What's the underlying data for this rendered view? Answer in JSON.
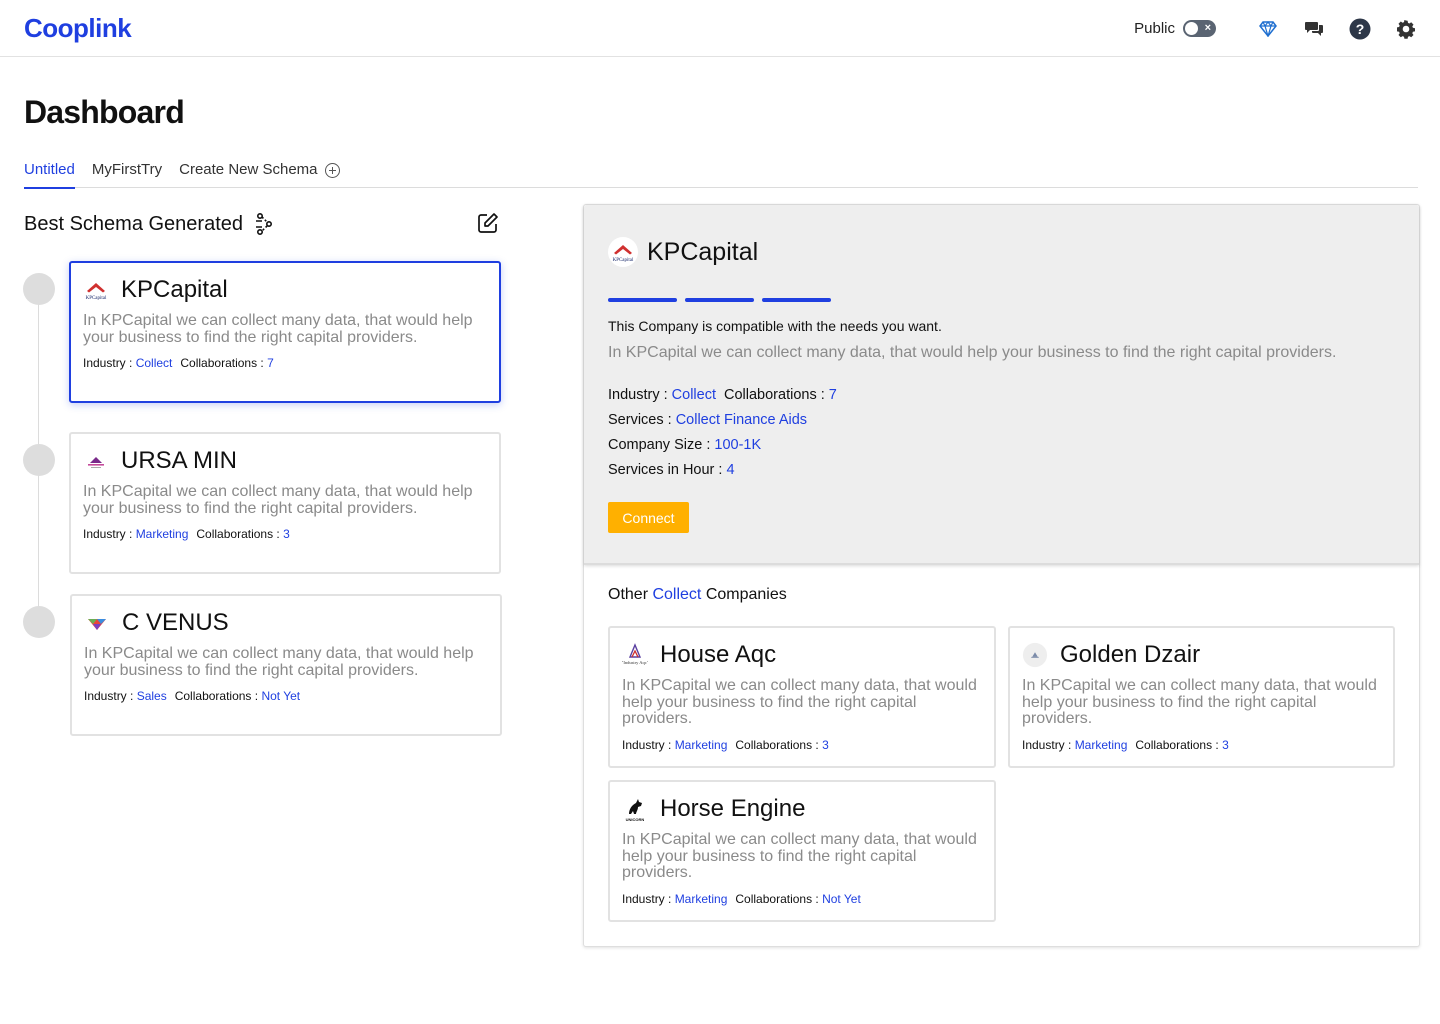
{
  "app": {
    "logo": "Cooplink"
  },
  "topbar": {
    "public_label": "Public",
    "icons": [
      "diamond-icon",
      "chat-icon",
      "help-icon",
      "gear-icon"
    ]
  },
  "page": {
    "title": "Dashboard"
  },
  "tabs": [
    {
      "label": "Untitled",
      "active": true
    },
    {
      "label": "MyFirstTry",
      "active": false
    },
    {
      "label": "Create New Schema",
      "active": false
    }
  ],
  "schema": {
    "title": "Best Schema Generated",
    "labels": {
      "industry": "Industry : ",
      "collaborations": "Collaborations : "
    },
    "cards": [
      {
        "name": "KPCapital",
        "desc": "In KPCapital we can collect many data, that would help your business to find the right capital providers.",
        "industry": "Collect",
        "collaborations": "7"
      },
      {
        "name": "URSA MIN",
        "desc": "In KPCapital we can collect many data, that would help your business to find the right capital providers.",
        "industry": "Marketing",
        "collaborations": "3"
      },
      {
        "name": "C VENUS",
        "desc": "In KPCapital we can collect many data, that would help your business to find the right capital providers.",
        "industry": "Sales",
        "collaborations": "Not Yet"
      }
    ]
  },
  "detail": {
    "name": "KPCapital",
    "compat": "This Company is compatible with the needs you want.",
    "desc": "In KPCapital we can collect many data, that would help your business to find the right capital providers.",
    "industry_label": "Industry : ",
    "industry": "Collect",
    "collab_label": "Collaborations : ",
    "collaborations": "7",
    "services_label": "Services : ",
    "services": "Collect Finance Aids",
    "size_label": "Company Size : ",
    "size": "100-1K",
    "hours_label": "Services in Hour : ",
    "hours": "4",
    "connect_label": "Connect",
    "compat_level": 3
  },
  "others": {
    "prefix": "Other ",
    "category": "Collect",
    "suffix": " Companies",
    "cards": [
      {
        "name": "House Aqc",
        "desc": "In KPCapital we can collect many data, that would help your business to find the right capital providers.",
        "industry": "Marketing",
        "collaborations": "3"
      },
      {
        "name": "Golden Dzair",
        "desc": "In KPCapital we can collect many data, that would help your business to find the right capital providers.",
        "industry": "Marketing",
        "collaborations": "3"
      },
      {
        "name": "Horse Engine",
        "desc": "In KPCapital we can collect many data, that would help your business to find the right capital providers.",
        "industry": "Marketing",
        "collaborations": "Not Yet"
      }
    ]
  },
  "colors": {
    "accent": "#1f3fe0",
    "connect": "#ffb000",
    "muted": "#8a8a8a"
  }
}
